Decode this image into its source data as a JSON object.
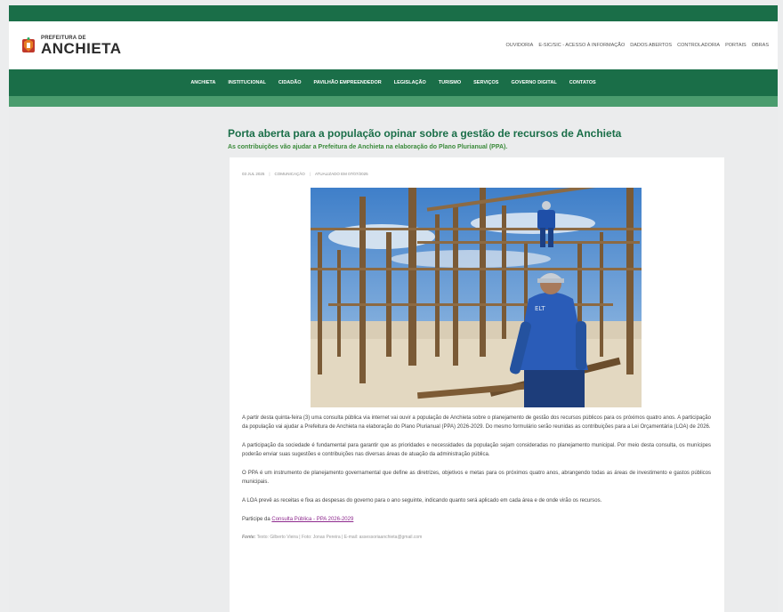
{
  "header": {
    "logo_small": "PREFEITURA DE",
    "logo_big": "ANCHIETA",
    "top_links": [
      "OUVIDORIA",
      "E-SIC/SIC - ACESSO À INFORMAÇÃO",
      "DADOS ABERTOS",
      "CONTROLADORIA",
      "PORTAIS",
      "OBRAS"
    ]
  },
  "nav": {
    "items": [
      "ANCHIETA",
      "INSTITUCIONAL",
      "CIDADÃO",
      "PAVILHÃO EMPREENDEDOR",
      "LEGISLAÇÃO",
      "TURISMO",
      "SERVIÇOS",
      "GOVERNO DIGITAL",
      "CONTATOS"
    ]
  },
  "article": {
    "title": "Porta aberta para a população opinar sobre a gestão de recursos de Anchieta",
    "subtitle": "As contribuições vão ajudar a Prefeitura de Anchieta na elaboração do Plano Plurianual (PPA).",
    "meta": {
      "date": "03 JUL 2025",
      "category": "COMUNICAÇÃO",
      "updated": "ATUALIZADO EM 07/07/2025"
    },
    "paragraphs": [
      "A partir desta quinta-feira (3) uma consulta pública via internet vai ouvir a população de Anchieta sobre o planejamento de gestão dos recursos públicos para os próximos quatro anos. A participação da população vai ajudar a Prefeitura de Anchieta na elaboração do Plano Plurianual (PPA) 2026-2029. Do mesmo formulário serão reunidas as contribuições para a Lei Orçamentária (LOA) de 2026.",
      "A participação da sociedade é fundamental para garantir que as prioridades e necessidades da população sejam consideradas no planejamento municipal. Por meio desta consulta, os munícipes poderão enviar suas sugestões e contribuições nas diversas áreas de atuação da administração pública.",
      "O PPA é um instrumento de planejamento governamental que define as diretrizes, objetivos e metas para os próximos quatro anos, abrangendo todas as áreas de investimento e gastos públicos municipais.",
      "A LOA prevê as receitas e fixa as despesas do governo para o ano seguinte, indicando quanto será aplicado em cada área e de onde virão os recursos."
    ],
    "cta_prefix": "Participe da",
    "cta_link": "Consulta Pública - PPA 2026-2029",
    "credit_label": "Fonte:",
    "credit_text": "Texto: Gilberto Vieira | Foto: Jonas Pereira | E-mail: assessoriaanchieta@gmail.com"
  },
  "colors": {
    "brand_green": "#1a6e48",
    "subtitle_green": "#3a8a3a",
    "link_purple": "#8e2a8e"
  },
  "icons": {
    "logo": "anchieta-crest-icon"
  }
}
